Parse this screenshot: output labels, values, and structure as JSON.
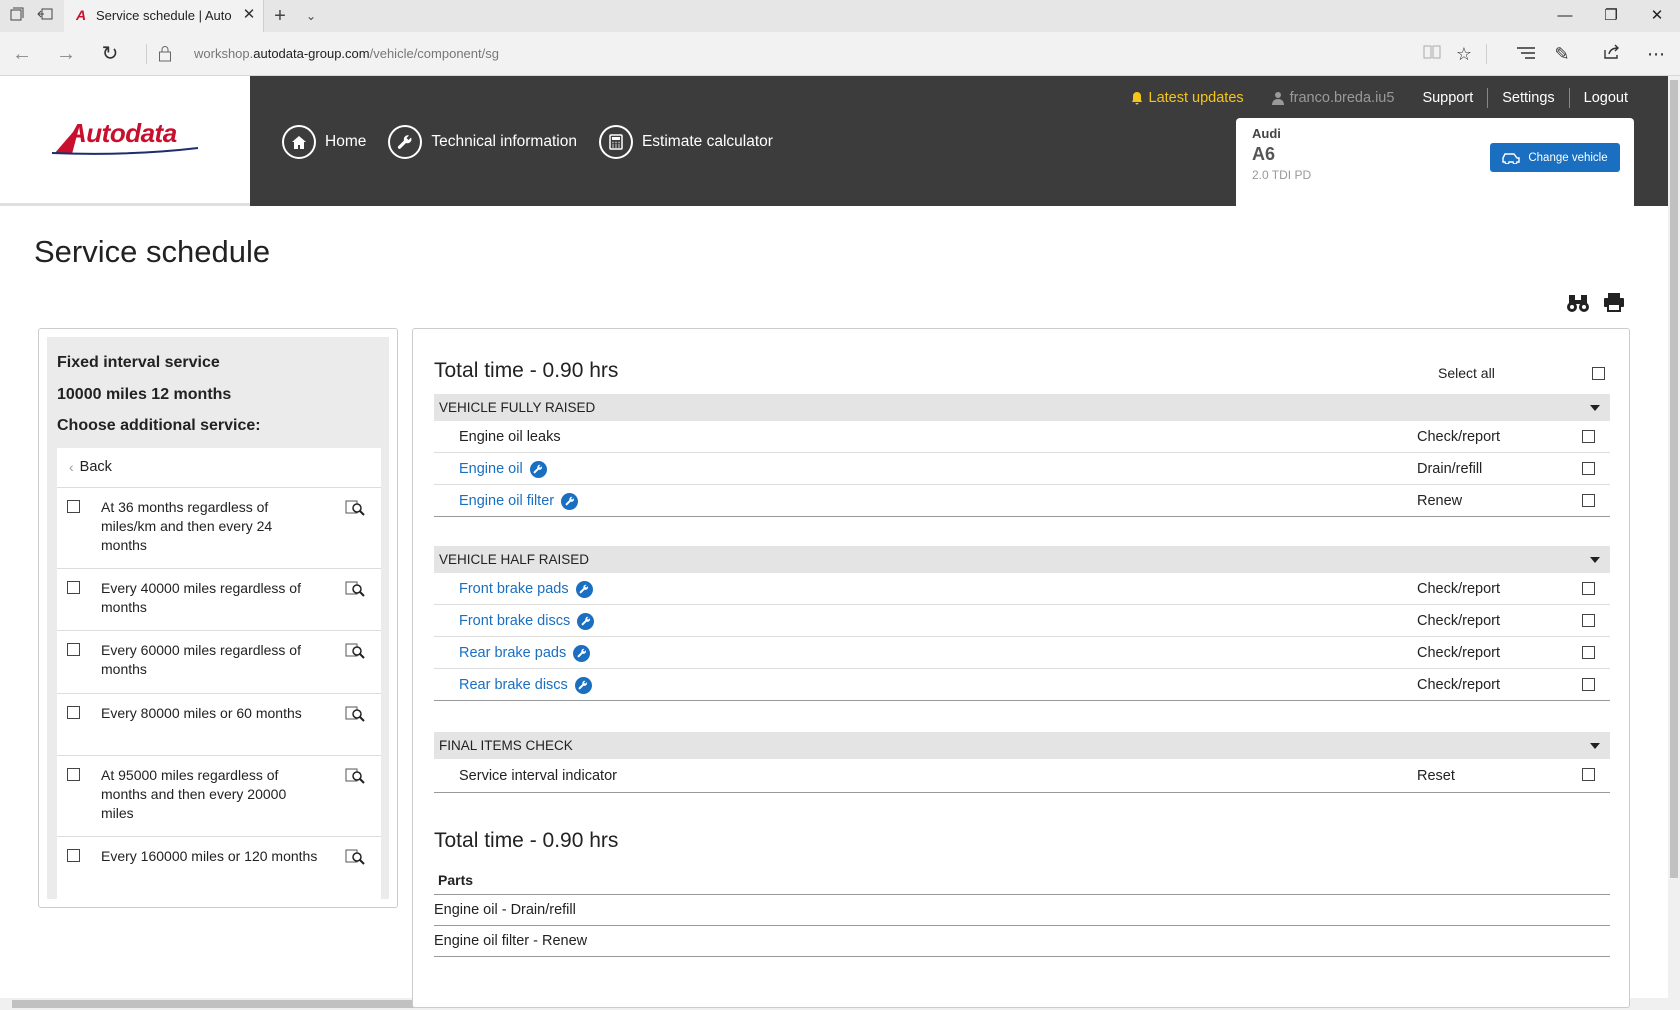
{
  "browser": {
    "tab_title": "Service schedule | Autodata",
    "url_prefix": "workshop.",
    "url_domain": "autodata-group.com",
    "url_path": "/vehicle/component/sg"
  },
  "header": {
    "logo_text": "Autodata",
    "nav": [
      {
        "label": "Home",
        "icon": "home-icon"
      },
      {
        "label": "Technical information",
        "icon": "wrench-icon"
      },
      {
        "label": "Estimate calculator",
        "icon": "calculator-icon"
      }
    ],
    "latest_updates": "Latest updates",
    "username": "franco.breda.iu5",
    "support": "Support",
    "settings": "Settings",
    "logout": "Logout",
    "vehicle": {
      "make": "Audi",
      "model": "A6",
      "engine": "2.0 TDI PD",
      "change_label": "Change vehicle"
    }
  },
  "page": {
    "title": "Service schedule"
  },
  "left_panel": {
    "line1": "Fixed interval service",
    "line2": "10000 miles 12 months",
    "line3": "Choose additional service:",
    "back_label": "Back",
    "options": [
      "At 36 months regardless of miles/km and then every 24 months",
      "Every 40000 miles regardless of months",
      "Every 60000 miles regardless of months",
      "Every 80000 miles or 60 months",
      "At 95000 miles regardless of months and then every 20000 miles",
      "Every 160000 miles or 120 months"
    ]
  },
  "schedule": {
    "total_top": "Total time - 0.90 hrs",
    "select_all": "Select all",
    "sections": [
      {
        "title": "VEHICLE FULLY RAISED",
        "rows": [
          {
            "name": "Engine oil leaks",
            "action": "Check/report",
            "link": false
          },
          {
            "name": "Engine oil",
            "action": "Drain/refill",
            "link": true
          },
          {
            "name": "Engine oil filter",
            "action": "Renew",
            "link": true
          }
        ]
      },
      {
        "title": "VEHICLE HALF RAISED",
        "rows": [
          {
            "name": "Front brake pads",
            "action": "Check/report",
            "link": true
          },
          {
            "name": "Front brake discs",
            "action": "Check/report",
            "link": true
          },
          {
            "name": "Rear brake pads",
            "action": "Check/report",
            "link": true
          },
          {
            "name": "Rear brake discs",
            "action": "Check/report",
            "link": true
          }
        ]
      },
      {
        "title": "FINAL ITEMS CHECK",
        "rows": [
          {
            "name": "Service interval indicator",
            "action": "Reset",
            "link": false
          }
        ]
      }
    ],
    "total_bottom": "Total time - 0.90 hrs",
    "parts_label": "Parts",
    "parts": [
      "Engine oil - Drain/refill",
      "Engine oil filter - Renew"
    ]
  },
  "colors": {
    "brand_red": "#c8102e",
    "link_blue": "#1a6fc0",
    "header_bg": "#3c3c3c",
    "updates_yellow": "#f5c518"
  }
}
